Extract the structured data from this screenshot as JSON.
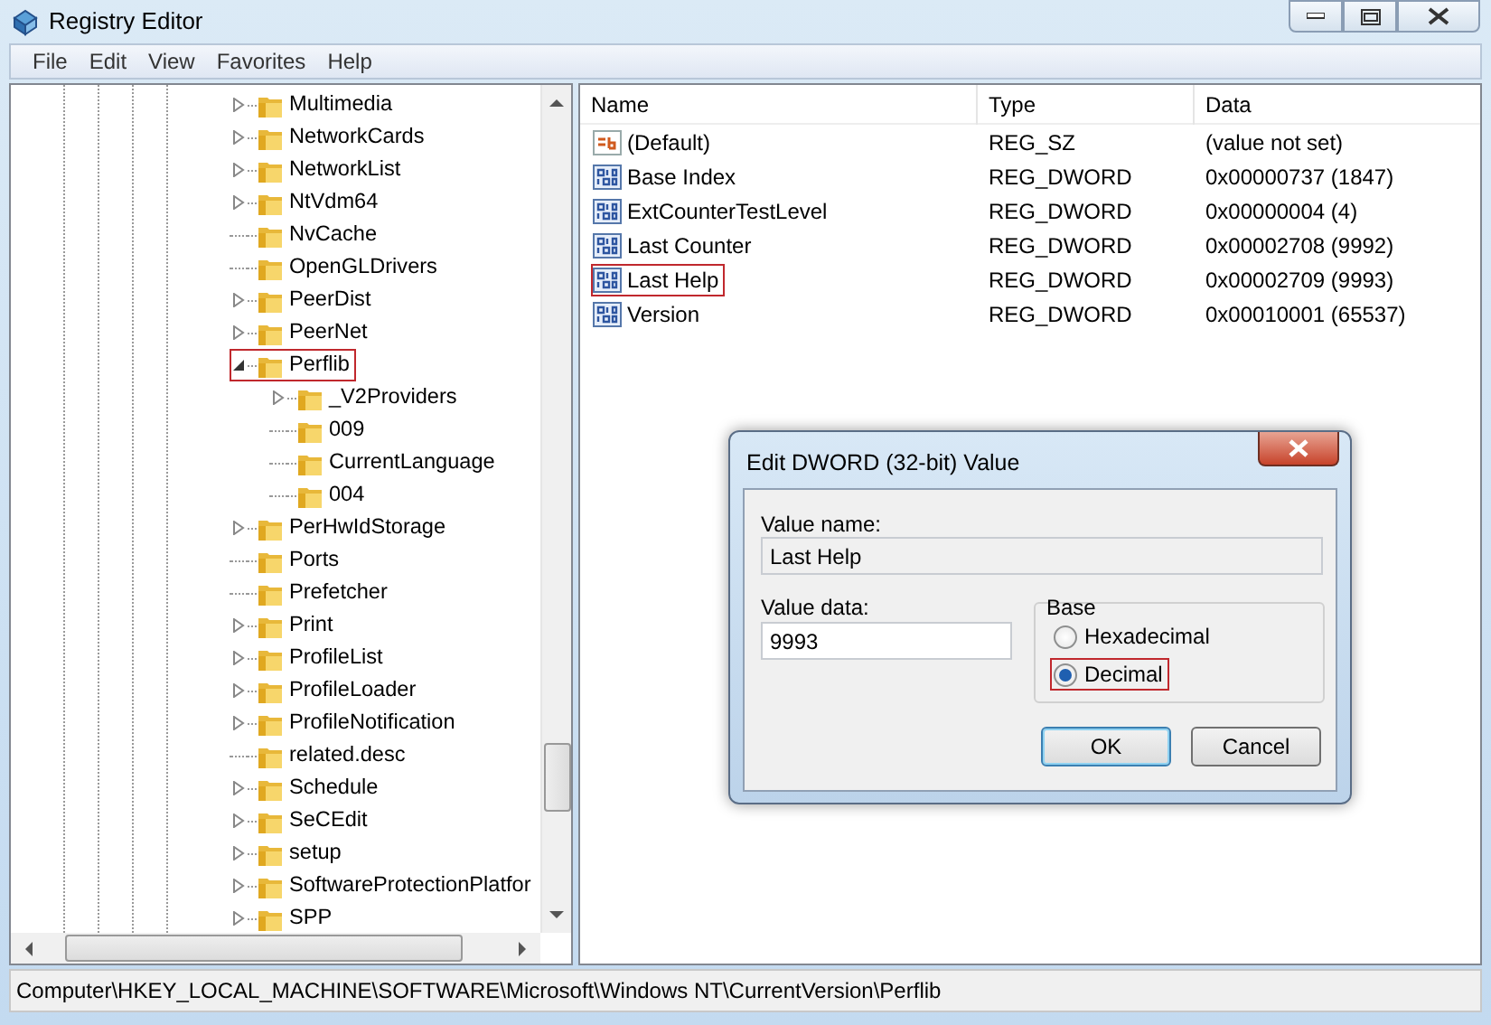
{
  "window": {
    "title": "Registry Editor"
  },
  "menu": [
    "File",
    "Edit",
    "View",
    "Favorites",
    "Help"
  ],
  "tree": [
    {
      "kind": "branch",
      "label": "Multimedia",
      "expanded": false,
      "highlighted": false
    },
    {
      "kind": "branch",
      "label": "NetworkCards",
      "expanded": false,
      "highlighted": false
    },
    {
      "kind": "branch",
      "label": "NetworkList",
      "expanded": false,
      "highlighted": false
    },
    {
      "kind": "branch",
      "label": "NtVdm64",
      "expanded": false,
      "highlighted": false
    },
    {
      "kind": "leaf",
      "label": "NvCache",
      "highlighted": false
    },
    {
      "kind": "leaf",
      "label": "OpenGLDrivers",
      "highlighted": false
    },
    {
      "kind": "branch",
      "label": "PeerDist",
      "expanded": false,
      "highlighted": false
    },
    {
      "kind": "branch",
      "label": "PeerNet",
      "expanded": false,
      "highlighted": false
    },
    {
      "kind": "branch",
      "label": "Perflib",
      "expanded": true,
      "highlighted": true,
      "children": [
        {
          "kind": "branch",
          "label": "_V2Providers",
          "expanded": false,
          "highlighted": false
        },
        {
          "kind": "leaf",
          "label": "009",
          "highlighted": false
        },
        {
          "kind": "leaf",
          "label": "CurrentLanguage",
          "highlighted": false
        },
        {
          "kind": "leaf",
          "label": "004",
          "highlighted": false
        }
      ]
    },
    {
      "kind": "branch",
      "label": "PerHwIdStorage",
      "expanded": false,
      "highlighted": false
    },
    {
      "kind": "leaf",
      "label": "Ports",
      "highlighted": false
    },
    {
      "kind": "leaf",
      "label": "Prefetcher",
      "highlighted": false
    },
    {
      "kind": "branch",
      "label": "Print",
      "expanded": false,
      "highlighted": false
    },
    {
      "kind": "branch",
      "label": "ProfileList",
      "expanded": false,
      "highlighted": false
    },
    {
      "kind": "branch",
      "label": "ProfileLoader",
      "expanded": false,
      "highlighted": false
    },
    {
      "kind": "branch",
      "label": "ProfileNotification",
      "expanded": false,
      "highlighted": false
    },
    {
      "kind": "leaf",
      "label": "related.desc",
      "highlighted": false
    },
    {
      "kind": "branch",
      "label": "Schedule",
      "expanded": false,
      "highlighted": false
    },
    {
      "kind": "branch",
      "label": "SeCEdit",
      "expanded": false,
      "highlighted": false
    },
    {
      "kind": "branch",
      "label": "setup",
      "expanded": false,
      "highlighted": false
    },
    {
      "kind": "branch",
      "label": "SoftwareProtectionPlatfor",
      "expanded": false,
      "highlighted": false
    },
    {
      "kind": "branch",
      "label": "SPP",
      "expanded": false,
      "highlighted": false
    }
  ],
  "values": {
    "columns": [
      "Name",
      "Type",
      "Data"
    ],
    "rows": [
      {
        "kind": "string",
        "name": "(Default)",
        "type": "REG_SZ",
        "data": "(value not set)",
        "highlighted": false
      },
      {
        "kind": "dword",
        "name": "Base Index",
        "type": "REG_DWORD",
        "data": "0x00000737 (1847)",
        "highlighted": false
      },
      {
        "kind": "dword",
        "name": "ExtCounterTestLevel",
        "type": "REG_DWORD",
        "data": "0x00000004 (4)",
        "highlighted": false
      },
      {
        "kind": "dword",
        "name": "Last Counter",
        "type": "REG_DWORD",
        "data": "0x00002708 (9992)",
        "highlighted": false
      },
      {
        "kind": "dword",
        "name": "Last Help",
        "type": "REG_DWORD",
        "data": "0x00002709 (9993)",
        "highlighted": true
      },
      {
        "kind": "dword",
        "name": "Version",
        "type": "REG_DWORD",
        "data": "0x00010001 (65537)",
        "highlighted": false
      }
    ]
  },
  "dialog": {
    "title": "Edit DWORD (32-bit) Value",
    "value_name_label": "Value name:",
    "value_name": "Last Help",
    "value_data_label": "Value data:",
    "value_data": "9993",
    "base_label": "Base",
    "radios": [
      {
        "label": "Hexadecimal",
        "selected": false,
        "highlighted": false
      },
      {
        "label": "Decimal",
        "selected": true,
        "highlighted": true
      }
    ],
    "buttons": [
      {
        "label": "OK",
        "default": true
      },
      {
        "label": "Cancel",
        "default": false
      }
    ]
  },
  "status_bar": "Computer\\HKEY_LOCAL_MACHINE\\SOFTWARE\\Microsoft\\Windows NT\\CurrentVersion\\Perflib"
}
